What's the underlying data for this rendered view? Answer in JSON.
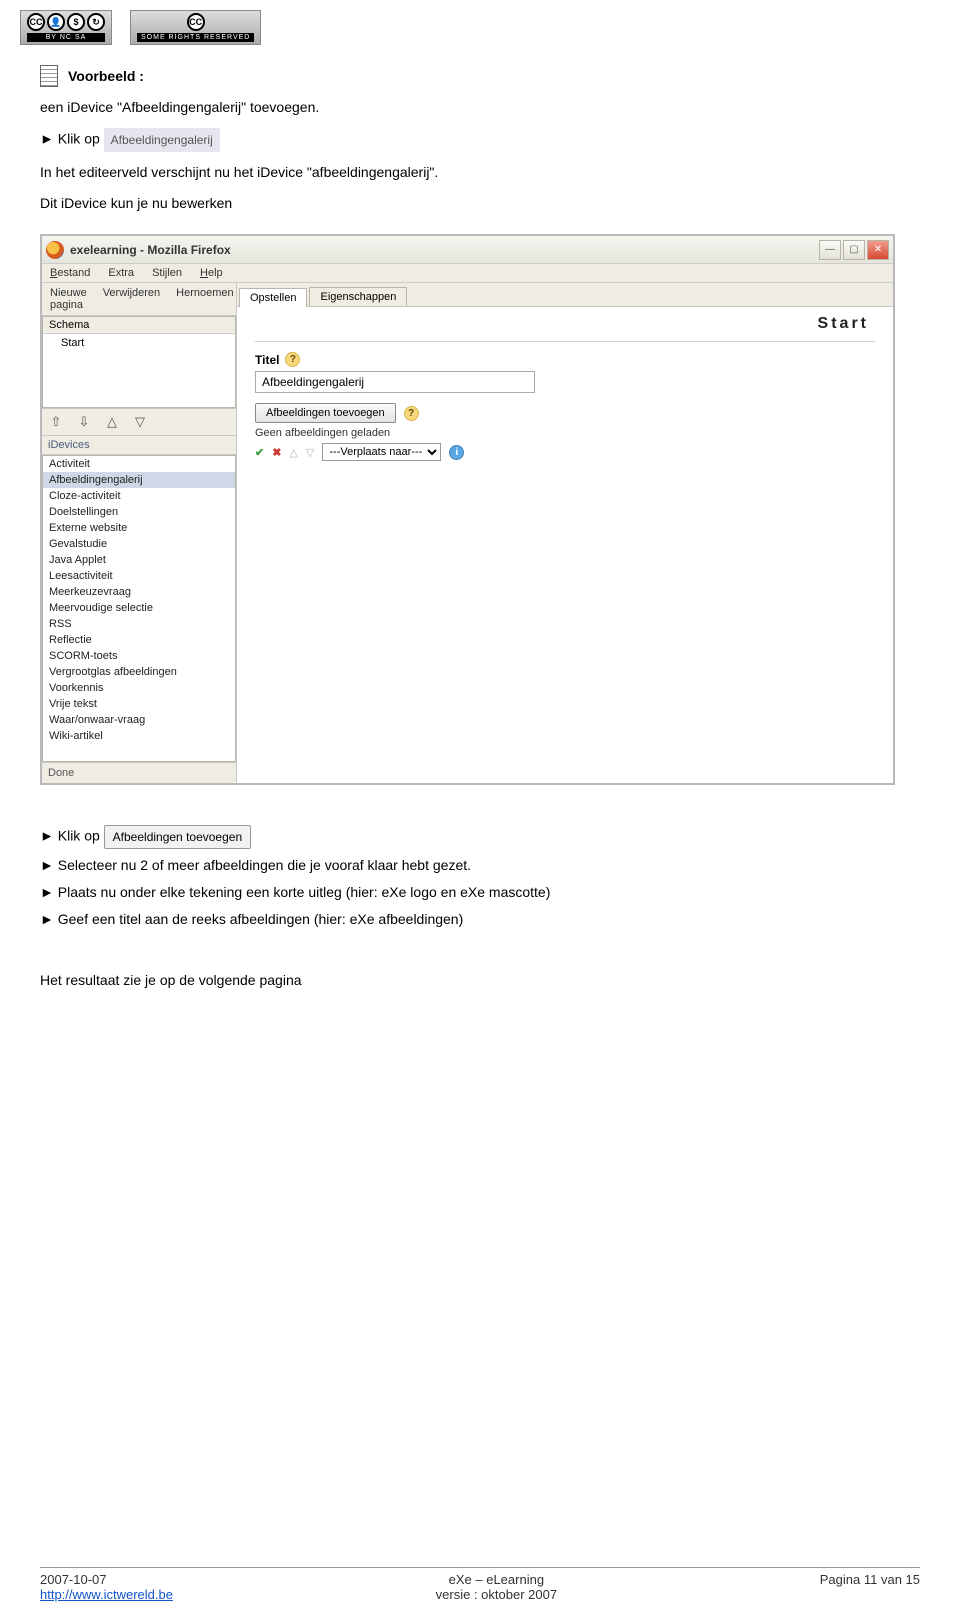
{
  "badges": {
    "left_bar": "BY NC SA",
    "right_bar": "SOME RIGHTS RESERVED"
  },
  "doc": {
    "voorbeeld": "Voorbeeld :",
    "line1": "een iDevice \"Afbeeldingengalerij\" toevoegen.",
    "line2_prefix": "► Klik op",
    "chip_afbeeld": "Afbeeldingengalerij",
    "line3": "In het editeerveld  verschijnt nu het iDevice \"afbeeldingengalerij\".",
    "line4": "Dit iDevice kun je nu bewerken",
    "line5_prefix": "► Klik op",
    "btn_afbeeld_toevoegen": "Afbeeldingen toevoegen",
    "line6": "► Selecteer nu 2 of meer afbeeldingen die je vooraf klaar hebt gezet.",
    "line7": "► Plaats nu onder elke tekening een korte uitleg  (hier: eXe logo en eXe mascotte)",
    "line8": "► Geef een titel aan de reeks afbeeldingen  (hier: eXe afbeeldingen)",
    "line9": "Het resultaat zie je op de volgende pagina"
  },
  "screenshot": {
    "title": "exelearning - Mozilla Firefox",
    "menubar": [
      "Bestand",
      "Extra",
      "Stijlen",
      "Help"
    ],
    "left": {
      "actions": [
        "Nieuwe pagina",
        "Verwijderen",
        "Hernoemen"
      ],
      "schema_hdr": "Schema",
      "schema_item": "Start",
      "idev_hdr": "iDevices",
      "idev_list": [
        "Activiteit",
        "Afbeeldingengalerij",
        "Cloze-activiteit",
        "Doelstellingen",
        "Externe website",
        "Gevalstudie",
        "Java Applet",
        "Leesactiviteit",
        "Meerkeuzevraag",
        "Meervoudige selectie",
        "RSS",
        "Reflectie",
        "SCORM-toets",
        "Vergrootglas afbeeldingen",
        "Voorkennis",
        "Vrije tekst",
        "Waar/onwaar-vraag",
        "Wiki-artikel"
      ],
      "idev_selected_index": 1,
      "done": "Done"
    },
    "right": {
      "tabs": [
        "Opstellen",
        "Eigenschappen"
      ],
      "active_tab_index": 0,
      "start_label": "Start",
      "field_label": "Titel",
      "field_value": "Afbeeldingengalerij",
      "add_btn": "Afbeeldingen toevoegen",
      "status": "Geen afbeeldingen geladen",
      "move_select": "---Verplaats naar---"
    }
  },
  "footer": {
    "left1": "2007-10-07",
    "left2_url": "http://www.ictwereld.be",
    "center1": "eXe – eLearning",
    "center2": "versie : oktober 2007",
    "right": "Pagina 11 van 15"
  }
}
